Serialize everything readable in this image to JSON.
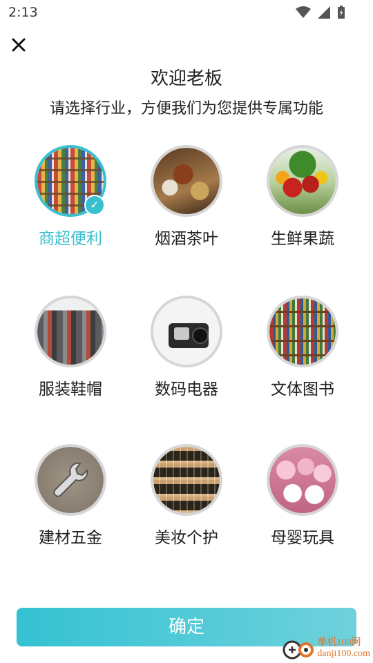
{
  "status_bar": {
    "time": "2:13"
  },
  "header": {
    "title": "欢迎老板",
    "subtitle": "请选择行业，方便我们为您提供专属功能"
  },
  "categories": [
    {
      "label": "商超便利",
      "icon": "supermarket-shelves-image",
      "selected": true
    },
    {
      "label": "烟酒茶叶",
      "icon": "tobacco-liquor-tea-image",
      "selected": false
    },
    {
      "label": "生鲜果蔬",
      "icon": "fresh-fruit-vegetable-image",
      "selected": false
    },
    {
      "label": "服装鞋帽",
      "icon": "clothing-rack-image",
      "selected": false
    },
    {
      "label": "数码电器",
      "icon": "camera-image",
      "selected": false
    },
    {
      "label": "文体图书",
      "icon": "bookshelf-image",
      "selected": false
    },
    {
      "label": "建材五金",
      "icon": "wrench-image",
      "selected": false
    },
    {
      "label": "美妆个护",
      "icon": "cosmetics-shelf-image",
      "selected": false
    },
    {
      "label": "母婴玩具",
      "icon": "plush-toys-image",
      "selected": false
    }
  ],
  "confirm_button": {
    "label": "确定"
  },
  "watermark": {
    "line1": "单机100网",
    "line2": "danji100.com"
  },
  "colors": {
    "accent": "#39c0cf",
    "button_start": "#34c2d2",
    "button_end": "#6fd1dc"
  }
}
